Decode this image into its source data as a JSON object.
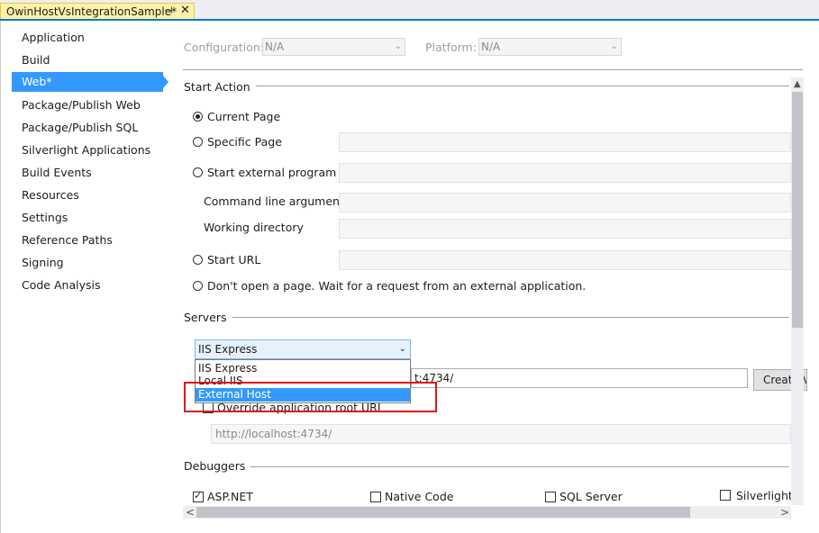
{
  "tab": {
    "title": "OwinHostVsIntegrationSample*",
    "pin_glyph": "⊣",
    "close_glyph": "✕"
  },
  "sidebar": {
    "items": [
      {
        "label": "Application"
      },
      {
        "label": "Build"
      },
      {
        "label": "Web*",
        "selected": true
      },
      {
        "label": "Package/Publish Web"
      },
      {
        "label": "Package/Publish SQL"
      },
      {
        "label": "Silverlight Applications"
      },
      {
        "label": "Build Events"
      },
      {
        "label": "Resources"
      },
      {
        "label": "Settings"
      },
      {
        "label": "Reference Paths"
      },
      {
        "label": "Signing"
      },
      {
        "label": "Code Analysis"
      }
    ]
  },
  "config": {
    "configuration_label": "Configuration:",
    "configuration_value": "N/A",
    "platform_label": "Platform:",
    "platform_value": "N/A"
  },
  "start_action": {
    "title": "Start Action",
    "current_page": "Current Page",
    "specific_page": "Specific Page",
    "start_external_program": "Start external program",
    "command_line_arguments": "Command line arguments",
    "working_directory": "Working directory",
    "start_url": "Start URL",
    "dont_open": "Don't open a page.  Wait for a request from an external application.",
    "selected": "current_page"
  },
  "servers": {
    "title": "Servers",
    "selected_server": "IIS Express",
    "options": [
      "IIS Express",
      "Local IIS",
      "External Host"
    ],
    "highlighted_option": "External Host",
    "project_url_visible": "t:4734/",
    "create_button": "Create Virtual Directory",
    "override_label": "Override application root URL",
    "override_checked": false,
    "root_url_value": "http://localhost:4734/"
  },
  "debuggers": {
    "title": "Debuggers",
    "asp_net": "ASP.NET",
    "asp_net_checked": true,
    "native_code": "Native Code",
    "native_code_checked": false,
    "sql_server": "SQL Server",
    "sql_server_checked": false,
    "silverlight": "Silverlight",
    "silverlight_checked": false
  },
  "icons": {
    "chevron_down": "⌄",
    "scroll_up": "▲",
    "scroll_left": "<",
    "scroll_right": ">"
  },
  "colors": {
    "accent": "#007acc",
    "selection": "#3399ff",
    "tab_active": "#fff1a8",
    "highlight_box": "#e0161b"
  }
}
